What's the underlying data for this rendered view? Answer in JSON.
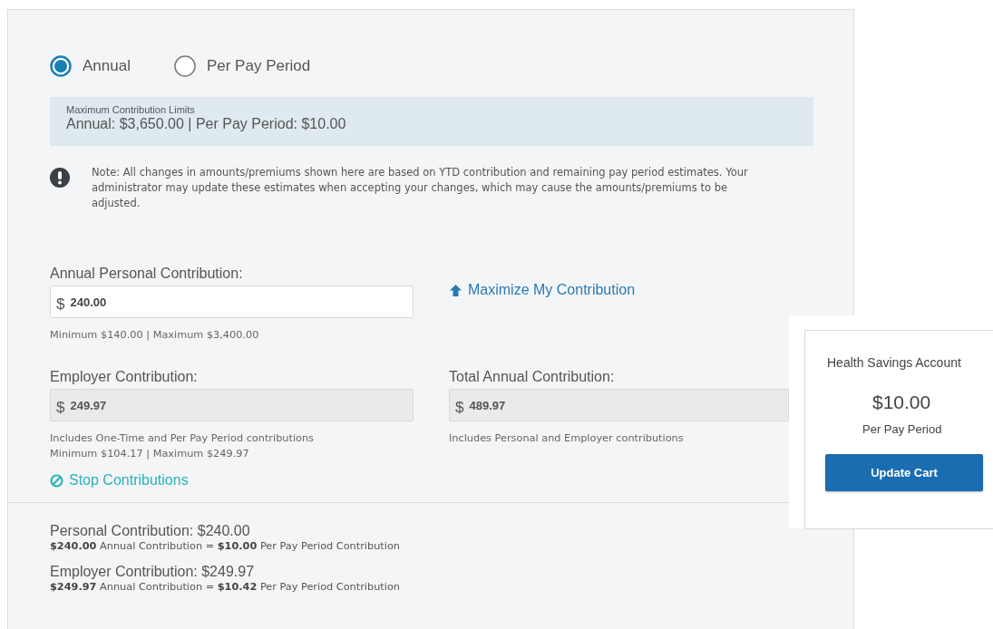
{
  "frequency_options": [
    {
      "label": "Annual",
      "selected": true
    },
    {
      "label": "Per Pay Period",
      "selected": false
    }
  ],
  "limits": {
    "title": "Maximum Contribution Limits",
    "text": "Annual: $3,650.00 | Per Pay Period: $10.00"
  },
  "note": "Note: All changes in amounts/premiums shown here are based on YTD contribution and remaining pay period estimates. Your administrator may update these estimates when accepting your changes, which may cause the amounts/premiums to be adjusted.",
  "personal": {
    "label": "Annual Personal Contribution:",
    "currency": "$",
    "value": "240.00",
    "disabled": false,
    "hints": [
      "Minimum $140.00 | Maximum $3,400.00"
    ]
  },
  "maximize_link": "Maximize My Contribution",
  "employer": {
    "label": "Employer Contribution:",
    "currency": "$",
    "value": "249.97",
    "disabled": true,
    "hints": [
      "Includes One-Time and Per Pay Period contributions",
      "Minimum $104.17 | Maximum $249.97"
    ]
  },
  "total": {
    "label": "Total Annual Contribution:",
    "currency": "$",
    "value": "489.97",
    "disabled": true,
    "hints": [
      "Includes Personal and Employer contributions"
    ]
  },
  "stop_link": "Stop Contributions",
  "summary": [
    {
      "title": "Personal Contribution: $240.00",
      "detail": "**$240.00** Annual Contribution = **$10.00** Per Pay Period Contribution"
    },
    {
      "title": "Employer Contribution: $249.97",
      "detail": "**$249.97** Annual Contribution = **$10.42** Per Pay Period Contribution"
    }
  ],
  "cart": {
    "title": "Health Savings Account",
    "amount": "$10.00",
    "period": "Per Pay Period",
    "button": "Update Cart"
  }
}
